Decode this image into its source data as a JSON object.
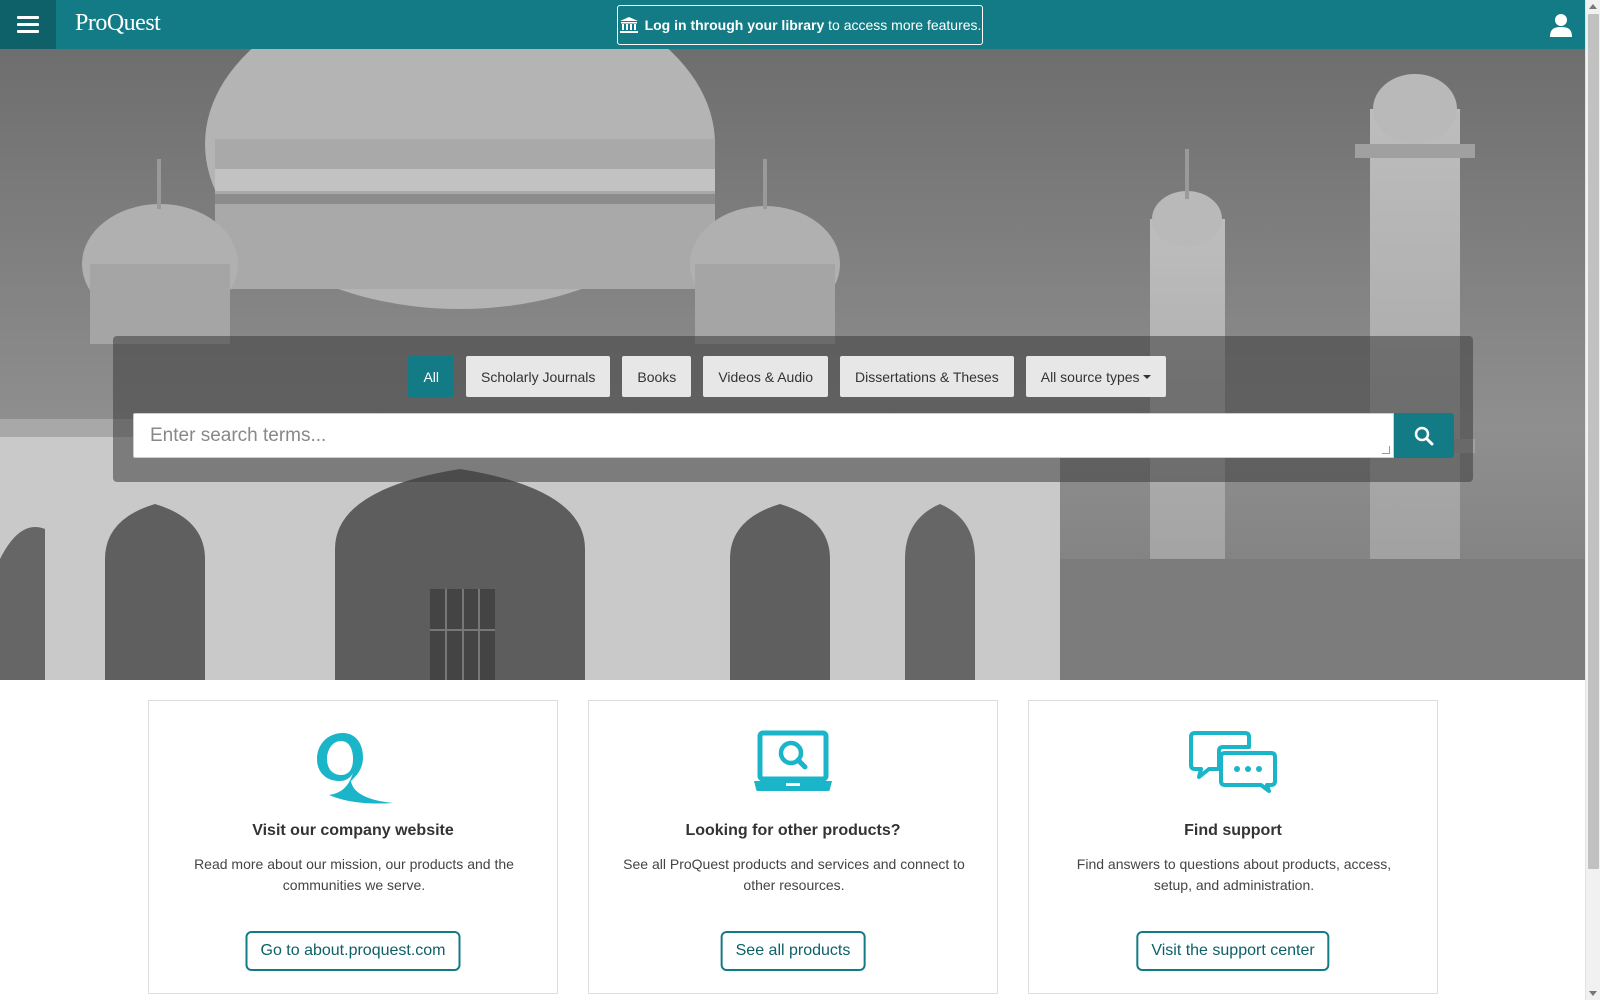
{
  "header": {
    "logo_text": "ProQuest",
    "menu_icon": "hamburger-menu-icon",
    "login": {
      "icon": "library-building-icon",
      "bold_text": "Log in through your library",
      "rest_text": "to access more features."
    },
    "user_icon": "user-account-icon"
  },
  "search": {
    "tabs": [
      {
        "label": "All",
        "active": true
      },
      {
        "label": "Scholarly Journals",
        "active": false
      },
      {
        "label": "Books",
        "active": false
      },
      {
        "label": "Videos & Audio",
        "active": false
      },
      {
        "label": "Dissertations & Theses",
        "active": false
      },
      {
        "label": "All source types",
        "active": false,
        "dropdown": true
      }
    ],
    "placeholder": "Enter search terms...",
    "button_icon": "search-icon"
  },
  "cards": [
    {
      "icon": "proquest-q-logo-icon",
      "title": "Visit our company website",
      "text": "Read more about our mission, our products and the communities we serve.",
      "button": "Go to about.proquest.com"
    },
    {
      "icon": "laptop-search-icon",
      "title": "Looking for other products?",
      "text": "See all ProQuest products and services and connect to other resources.",
      "button": "See all products"
    },
    {
      "icon": "chat-bubbles-icon",
      "title": "Find support",
      "text": "Find answers to questions about products, access, setup, and administration.",
      "button": "Visit the support center"
    }
  ],
  "colors": {
    "brand_teal": "#137b85",
    "brand_teal_dark": "#0e6069",
    "icon_cyan": "#1ab5c9"
  }
}
